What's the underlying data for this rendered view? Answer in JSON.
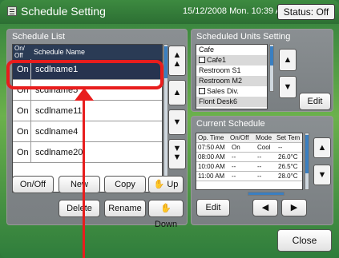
{
  "window": {
    "title": "Schedule Setting",
    "datetime": "15/12/2008 Mon. 10:39 AM",
    "status": "Status: Off"
  },
  "schedule_list": {
    "title": "Schedule List",
    "header_onoff": "On/ Off",
    "header_name": "Schedule Name",
    "rows": [
      {
        "state": "On",
        "name": "scdlname1",
        "selected": true
      },
      {
        "state": "On",
        "name": "scdlname5"
      },
      {
        "state": "On",
        "name": "scdlname11"
      },
      {
        "state": "On",
        "name": "scdlname4"
      },
      {
        "state": "On",
        "name": "scdlname20"
      }
    ],
    "buttons": {
      "onoff": "On/Off",
      "new": "New",
      "copy": "Copy",
      "up": "Up",
      "delete": "Delete",
      "rename": "Rename",
      "down": "Down"
    }
  },
  "scheduled_units": {
    "title": "Scheduled Units Setting",
    "items": [
      "Cafe",
      "Cafe1",
      "Restroom S1",
      "Restroom M2",
      "Sales Div.",
      "Flont Desk6"
    ],
    "edit_label": "Edit"
  },
  "current_schedule": {
    "title": "Current Schedule",
    "columns": [
      "Op. Time",
      "On/Off",
      "Mode",
      "Set Tem"
    ],
    "rows": [
      [
        "07:50 AM",
        "On",
        "Cool",
        "--"
      ],
      [
        "08:00 AM",
        "--",
        "--",
        "26.0°C"
      ],
      [
        "10:00 AM",
        "--",
        "--",
        "26.5°C"
      ],
      [
        "11:00 AM",
        "--",
        "--",
        "28.0°C"
      ]
    ],
    "edit_label": "Edit"
  },
  "footer": {
    "close_label": "Close"
  },
  "colors": {
    "background": "#3f8f43",
    "panel": "#848a8d",
    "selected_row": "#27334f",
    "highlight": "#e81d1d"
  }
}
